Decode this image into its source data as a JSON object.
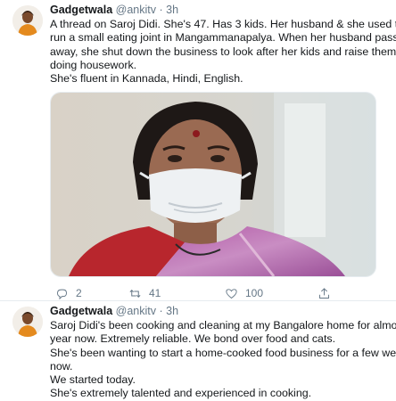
{
  "tweets": [
    {
      "display_name": "Gadgetwala",
      "handle": "@ankitv",
      "separator": "·",
      "time": "3h",
      "lines": [
        "A thread on Saroj Didi. She's 47. Has 3 kids. Her husband & she used to",
        "run a small eating joint in Mangammanapalya. When her husband passed",
        "away, she shut down the business to look after her kids and raise them by",
        "doing housework.",
        "She's fluent in Kannada, Hindi, English."
      ],
      "actions": {
        "replies": "2",
        "retweets": "41",
        "likes": "100"
      }
    },
    {
      "display_name": "Gadgetwala",
      "handle": "@ankitv",
      "separator": "·",
      "time": "3h",
      "lines": [
        "Saroj Didi's been cooking and cleaning at my Bangalore home for almost a",
        "year now. Extremely reliable. We bond over food and cats.",
        "She's been wanting to start a home-cooked food business for a few weeks",
        "now.",
        "We started today.",
        "She's extremely talented and experienced in cooking."
      ]
    }
  ],
  "icons": {
    "reply": "reply-icon",
    "retweet": "retweet-icon",
    "like": "heart-icon",
    "share": "share-icon"
  },
  "colors": {
    "text": "#14171a",
    "secondary": "#657786",
    "divider": "#e6ecf0"
  }
}
